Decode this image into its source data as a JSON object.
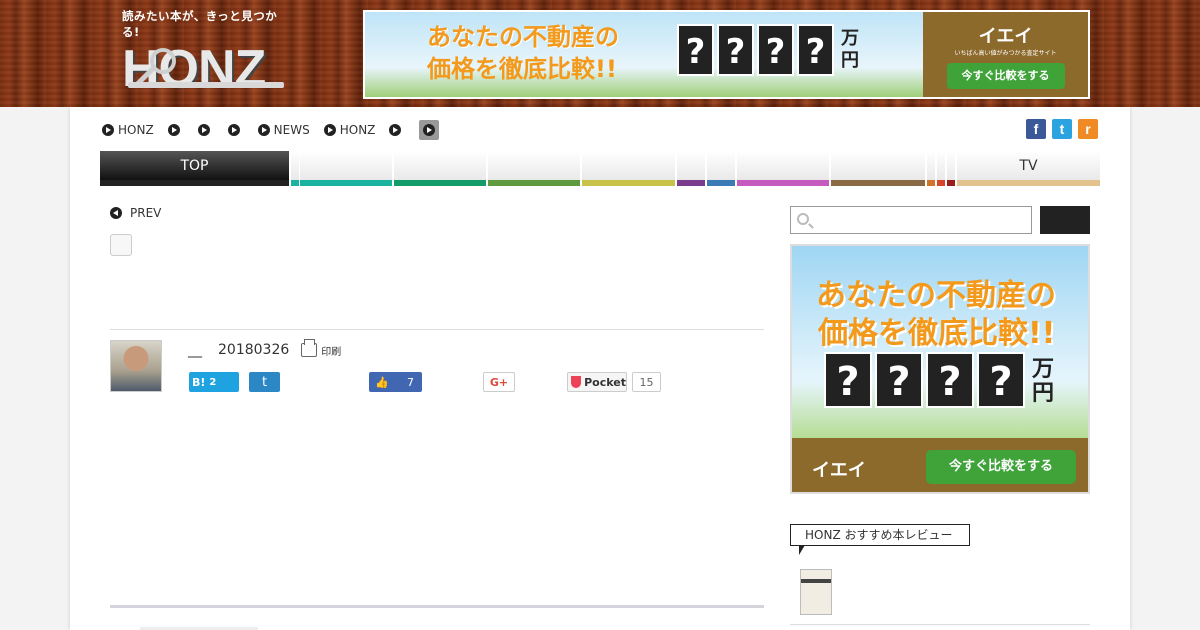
{
  "header": {
    "tagline": "読みたい本が、きっと見つかる!",
    "logo_text": "HONZ"
  },
  "top_ad": {
    "headline_1": "あなたの不動産の",
    "headline_2": "価格を徹底比較!!",
    "question_marks": [
      "?",
      "?",
      "?",
      "?"
    ],
    "unit": "万円",
    "brand": "イエイ",
    "brand_sub": "いちばん高い値がみつかる査定サイト",
    "cta": "今すぐ比較をする"
  },
  "breadcrumbs": [
    {
      "label": "HONZ"
    },
    {
      "label": ""
    },
    {
      "label": ""
    },
    {
      "label": ""
    },
    {
      "label": "NEWS"
    },
    {
      "label": "HONZ"
    },
    {
      "label": ""
    },
    {
      "label": ""
    }
  ],
  "social_top": {
    "facebook": "f",
    "twitter": "t",
    "rss": "r"
  },
  "nav": {
    "top_label": "TOP",
    "tv_label": "TV",
    "colors": [
      "#222222",
      "#1bb3a0",
      "#1ea58b",
      "#149b6a",
      "#5e9a3e",
      "#c8c24a",
      "#7a3c8c",
      "#3a7ab5",
      "#c65bbf",
      "#8a6a44",
      "#d0732b",
      "#d4452b",
      "#9a1d1d",
      "#e2c28d"
    ]
  },
  "article": {
    "prev_label": "PREV",
    "author_name": "__",
    "date": "20180326",
    "print_label": "印刷",
    "hatena_label": "B!",
    "hatena_count": "2",
    "twitter_label": "t",
    "fb_count": "7",
    "gplus_label": "G+",
    "pocket_label": "Pocket",
    "pocket_count": "15"
  },
  "sidebar": {
    "search_placeholder": "",
    "ad_headline_1": "あなたの不動産の",
    "ad_headline_2": "価格を徹底比較!!",
    "ad_question_marks": [
      "?",
      "?",
      "?",
      "?"
    ],
    "ad_unit": "万円",
    "ad_brand": "イエイ",
    "ad_cta": "今すぐ比較をする",
    "review_heading": "HONZ おすすめ本レビュー"
  }
}
